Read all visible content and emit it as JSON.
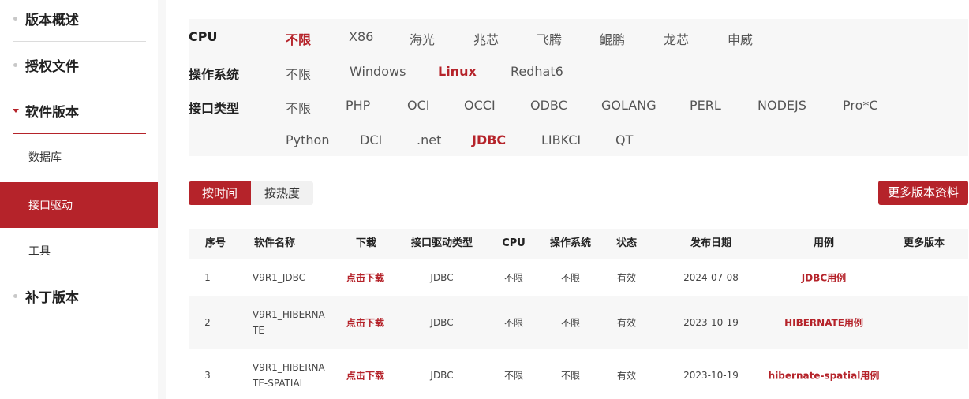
{
  "sidebar": {
    "overview": "版本概述",
    "license": "授权文件",
    "software": "软件版本",
    "sub_database": "数据库",
    "sub_driver": "接口驱动",
    "sub_tools": "工具",
    "patch": "补丁版本"
  },
  "filters": {
    "cpu": {
      "label": "CPU",
      "options": [
        "不限",
        "X86",
        "海光",
        "兆芯",
        "飞腾",
        "鲲鹏",
        "龙芯",
        "申威"
      ]
    },
    "os": {
      "label": "操作系统",
      "options": [
        "不限",
        "Windows",
        "Linux",
        "Redhat6"
      ]
    },
    "iface": {
      "label": "接口类型",
      "options": [
        "不限",
        "PHP",
        "OCI",
        "OCCI",
        "ODBC",
        "GOLANG",
        "PERL",
        "NODEJS",
        "Pro*C",
        "Python",
        "DCI",
        ".net",
        "JDBC",
        "LIBKCI",
        "QT"
      ]
    }
  },
  "sort": {
    "by_time": "按时间",
    "by_hot": "按热度"
  },
  "more_docs": "更多版本资料",
  "table": {
    "headers": [
      "序号",
      "软件名称",
      "下载",
      "接口驱动类型",
      "CPU",
      "操作系统",
      "状态",
      "发布日期",
      "用例",
      "更多版本"
    ],
    "rows": [
      {
        "no": "1",
        "name": "V9R1_JDBC",
        "download": "点击下载",
        "driver": "JDBC",
        "cpu": "不限",
        "os": "不限",
        "status": "有效",
        "date": "2024-07-08",
        "example": "JDBC用例"
      },
      {
        "no": "2",
        "name": "V9R1_HIBERNATE",
        "download": "点击下载",
        "driver": "JDBC",
        "cpu": "不限",
        "os": "不限",
        "status": "有效",
        "date": "2023-10-19",
        "example": "HIBERNATE用例"
      },
      {
        "no": "3",
        "name": "V9R1_HIBERNATE-SPATIAL",
        "download": "点击下载",
        "driver": "JDBC",
        "cpu": "不限",
        "os": "不限",
        "status": "有效",
        "date": "2023-10-19",
        "example": "hibernate-spatial用例"
      }
    ]
  },
  "colors": {
    "accent": "#b5232a",
    "panel_bg": "#f7f7f7"
  }
}
